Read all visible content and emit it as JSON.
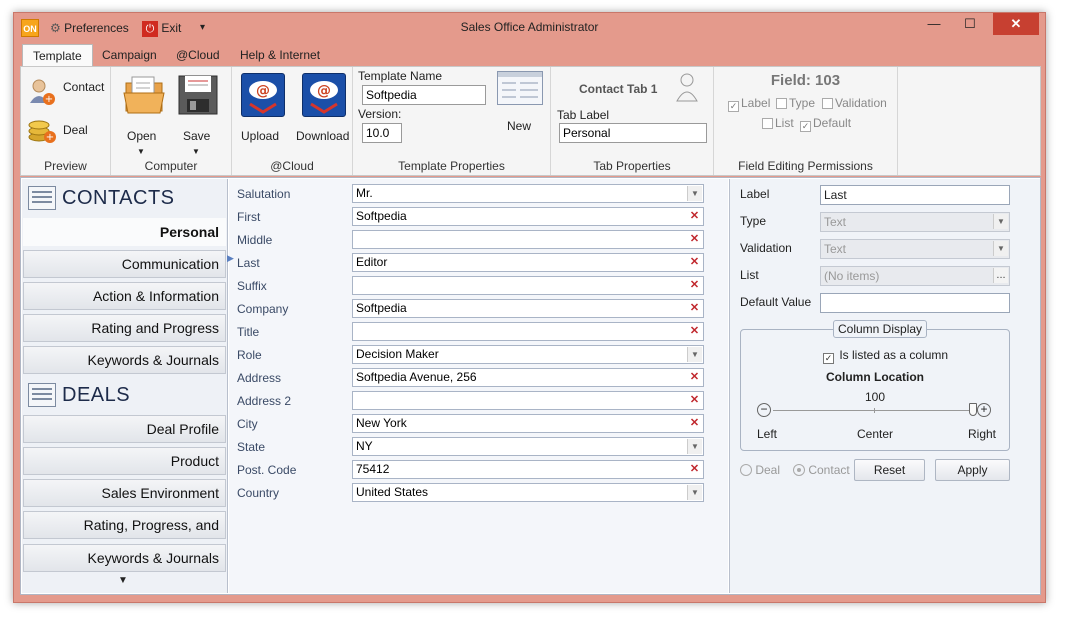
{
  "window": {
    "title": "Sales Office Administrator",
    "app_badge": "ON"
  },
  "quick_access": {
    "preferences": "Preferences",
    "exit": "Exit",
    "customize": "▾"
  },
  "window_controls": {
    "minimize": "—",
    "maximize": "☐",
    "close": "✕"
  },
  "tabs": [
    "Template",
    "Campaign",
    "@Cloud",
    "Help & Internet"
  ],
  "ribbon": {
    "preview": {
      "label": "Preview",
      "contact": "Contact",
      "deal": "Deal"
    },
    "computer": {
      "label": "Computer",
      "open": "Open",
      "save": "Save"
    },
    "cloud": {
      "label": "@Cloud",
      "upload": "Upload",
      "download": "Download"
    },
    "template_properties": {
      "label": "Template Properties",
      "name_label": "Template Name",
      "name_value": "Softpedia",
      "version_label": "Version:",
      "version_value": "10.0",
      "new": "New"
    },
    "tab_properties": {
      "label": "Tab Properties",
      "contact_tab": "Contact Tab 1",
      "tab_label": "Tab Label",
      "tab_label_value": "Personal"
    },
    "field_permissions": {
      "label": "Field Editing Permissions",
      "field_title": "Field: 103",
      "options": [
        "Label",
        "Type",
        "Validation",
        "List",
        "Default"
      ],
      "checked": [
        "Label",
        "Default"
      ]
    }
  },
  "nav": {
    "contacts_title": "CONTACTS",
    "contacts_items": [
      "Personal",
      "Communication",
      "Action & Information",
      "Rating and Progress",
      "Keywords & Journals"
    ],
    "deals_title": "DEALS",
    "deals_items": [
      "Deal Profile",
      "Product",
      "Sales Environment",
      "Rating, Progress, and Probability",
      "Keywords & Journals"
    ],
    "more": "▼",
    "selected": "Personal"
  },
  "form": {
    "fields": [
      {
        "label": "Salutation",
        "value": "Mr.",
        "kind": "dropdown"
      },
      {
        "label": "First",
        "value": "Softpedia",
        "kind": "clear"
      },
      {
        "label": "Middle",
        "value": "",
        "kind": "clear"
      },
      {
        "label": "Last",
        "value": "Editor",
        "kind": "clear"
      },
      {
        "label": "Suffix",
        "value": "",
        "kind": "clear"
      },
      {
        "label": "Company",
        "value": "Softpedia",
        "kind": "clear"
      },
      {
        "label": "Title",
        "value": "",
        "kind": "clear"
      },
      {
        "label": "Role",
        "value": "Decision Maker",
        "kind": "dropdown"
      },
      {
        "label": "Address",
        "value": "Softpedia Avenue, 256",
        "kind": "clear"
      },
      {
        "label": "Address 2",
        "value": "",
        "kind": "clear"
      },
      {
        "label": "City",
        "value": "New York",
        "kind": "clear"
      },
      {
        "label": "State",
        "value": "NY",
        "kind": "dropdown"
      },
      {
        "label": "Post. Code",
        "value": "75412",
        "kind": "clear"
      },
      {
        "label": "Country",
        "value": "United States",
        "kind": "dropdown"
      }
    ],
    "active_marker": "▶"
  },
  "properties": {
    "label_label": "Label",
    "label_value": "Last",
    "type_label": "Type",
    "type_value": "Text",
    "validation_label": "Validation",
    "validation_value": "Text",
    "list_label": "List",
    "list_value": "(No items)",
    "list_btn": "...",
    "default_label": "Default Value",
    "default_value": "",
    "column_display": "Column Display",
    "listed_as_column": "Is listed as a column",
    "column_location": "Column Location",
    "location_value": "100",
    "left": "Left",
    "center": "Center",
    "right": "Right",
    "radio_deal": "Deal",
    "radio_contact": "Contact",
    "reset": "Reset",
    "apply": "Apply"
  },
  "colors": {
    "titlebar": "#e49a8c",
    "close": "#c74031",
    "accent": "#1d2b4a"
  }
}
